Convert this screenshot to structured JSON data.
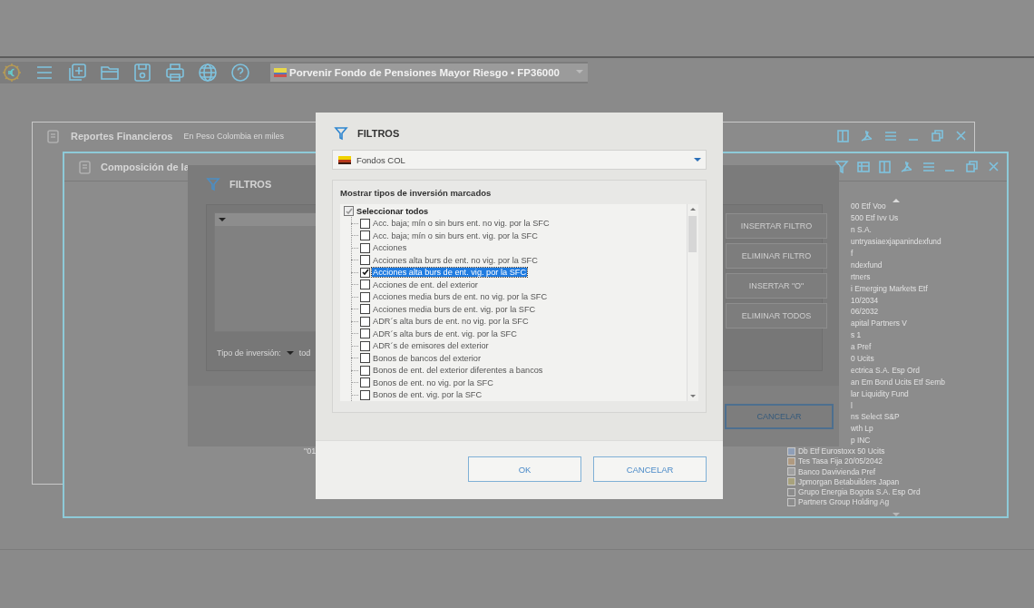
{
  "toolbar": {
    "fund_selector": "Porvenir Fondo de Pensiones Mayor Riesgo • FP36000"
  },
  "report_window": {
    "title": "Reportes Financieros",
    "subtitle": "En Peso Colombia en miles"
  },
  "composition_window": {
    "title": "Composición de la",
    "holdings": [
      {
        "kind": "covered",
        "text": "00 Etf Voo"
      },
      {
        "kind": "covered",
        "text": "500 Etf Ivv Us"
      },
      {
        "kind": "covered",
        "text": "n S.A."
      },
      {
        "kind": "covered",
        "text": "untryasiaexjapanindexfund"
      },
      {
        "kind": "covered",
        "text": "f"
      },
      {
        "kind": "covered",
        "text": "ndexfund"
      },
      {
        "kind": "covered",
        "text": "rtners"
      },
      {
        "kind": "covered",
        "text": "i Emerging Markets Etf"
      },
      {
        "kind": "covered",
        "text": "10/2034"
      },
      {
        "kind": "covered",
        "text": "06/2032"
      },
      {
        "kind": "covered",
        "text": "apital Partners V"
      },
      {
        "kind": "covered",
        "text": "s 1"
      },
      {
        "kind": "covered",
        "text": "a Pref"
      },
      {
        "kind": "covered",
        "text": "0 Ucits"
      },
      {
        "kind": "covered",
        "text": "ectrica S.A. Esp Ord"
      },
      {
        "kind": "covered",
        "text": "an Em Bond Ucits Etf Semb"
      },
      {
        "kind": "covered",
        "text": "lar Liquidity Fund"
      },
      {
        "kind": "covered",
        "text": "l"
      },
      {
        "kind": "covered",
        "text": "ns Select S&P"
      },
      {
        "kind": "covered",
        "text": "wth Lp"
      },
      {
        "kind": "covered",
        "text": "p INC"
      },
      {
        "kind": "legend",
        "text": "Db Etf Eurostoxx 50 Ucits",
        "color": "#8f9fb8"
      },
      {
        "kind": "legend",
        "text": "Tes Tasa Fija 20/05/2042",
        "color": "#b09a80"
      },
      {
        "kind": "legend",
        "text": "Banco Davivienda Pref",
        "color": "#a0a0a0"
      },
      {
        "kind": "legend",
        "text": "Jpmorgan Betabuilders Japan",
        "color": "#a8a27c"
      },
      {
        "kind": "legend",
        "text": "Grupo Energia Bogota S.A. Esp Ord",
        "color": "#8c8c8c"
      },
      {
        "kind": "legend",
        "text": "Partners Group Holding Ag",
        "color": "#8c8c8c"
      }
    ]
  },
  "background_filter": {
    "title": "FILTROS",
    "buttons": [
      "INSERTAR FILTRO",
      "ELIMINAR FILTRO",
      "INSERTAR \"O\"",
      "ELIMINAR TODOS"
    ],
    "type_label": "Tipo de inversión:",
    "type_value": "tod",
    "cancel": "CANCELAR",
    "fragment": "\"01"
  },
  "dialog": {
    "title": "FILTROS",
    "fund_dropdown": "Fondos COL",
    "group_title": "Mostrar tipos de inversión marcados",
    "select_all": {
      "label": "Seleccionar todos",
      "checked": true
    },
    "items": [
      {
        "label": "Acc. baja; mín o sin burs ent. no vig. por la SFC",
        "checked": false,
        "selected": false
      },
      {
        "label": "Acc. baja; mín o sin burs ent. vig. por la SFC",
        "checked": false,
        "selected": false
      },
      {
        "label": "Acciones",
        "checked": false,
        "selected": false
      },
      {
        "label": "Acciones alta burs de ent. no vig. por la SFC",
        "checked": false,
        "selected": false
      },
      {
        "label": "Acciones alta burs de ent. vig. por la SFC",
        "checked": true,
        "selected": true
      },
      {
        "label": "Acciones de ent. del exterior",
        "checked": false,
        "selected": false
      },
      {
        "label": "Acciones media burs de ent. no vig. por la SFC",
        "checked": false,
        "selected": false
      },
      {
        "label": "Acciones media burs de ent. vig. por la SFC",
        "checked": false,
        "selected": false
      },
      {
        "label": "ADR´s alta burs de ent. no vig. por la SFC",
        "checked": false,
        "selected": false
      },
      {
        "label": "ADR´s alta burs de ent. vig. por la SFC",
        "checked": false,
        "selected": false
      },
      {
        "label": "ADR´s de emisores del exterior",
        "checked": false,
        "selected": false
      },
      {
        "label": "Bonos de bancos del exterior",
        "checked": false,
        "selected": false
      },
      {
        "label": "Bonos de ent. del exterior diferentes a bancos",
        "checked": false,
        "selected": false
      },
      {
        "label": "Bonos de ent. no vig. por la SFC",
        "checked": false,
        "selected": false
      },
      {
        "label": "Bonos de ent. vig. por la SFC",
        "checked": false,
        "selected": false
      }
    ],
    "buttons": [
      "OK",
      "CANCELAR"
    ]
  }
}
